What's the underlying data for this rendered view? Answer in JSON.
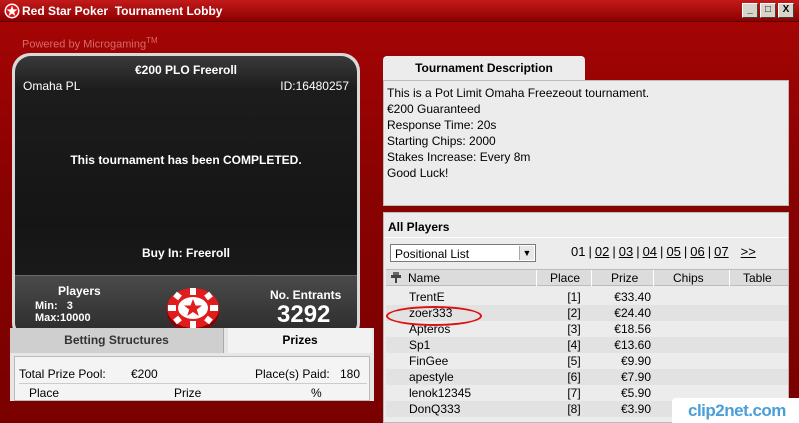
{
  "window": {
    "title": "Red Star Poker  Tournament Lobby",
    "minimize_label": "_",
    "restore_label": "□",
    "close_label": "X"
  },
  "header": {
    "powered_by": "Powered by Microgaming",
    "tm": "TM"
  },
  "tournament": {
    "name": "€200 PLO Freeroll",
    "game": "Omaha PL",
    "id": "ID:16480257",
    "status": "This tournament has been COMPLETED.",
    "buy_in": "Buy In: Freeroll",
    "players_label": "Players",
    "min": "Min:   3",
    "max": "Max:10000",
    "entrants_label": "No. Entrants",
    "entrants": "3292"
  },
  "left_tabs": {
    "betting": "Betting Structures",
    "prizes": "Prizes"
  },
  "prizes": {
    "total_label": "Total Prize Pool:",
    "total_value": "€200",
    "paid_label": "Place(s) Paid:",
    "paid_value": "180",
    "col_place": "Place",
    "col_prize": "Prize",
    "col_pct": "%"
  },
  "description": {
    "tab": "Tournament Description",
    "lines": [
      "This is a Pot Limit Omaha Freezeout tournament.",
      "€200 Guaranteed",
      "Response Time: 20s",
      "Starting Chips: 2000",
      "Stakes Increase: Every 8m",
      "Good Luck!"
    ]
  },
  "players": {
    "title": "All Players",
    "view": "Positional List",
    "pages": [
      "01",
      "02",
      "03",
      "04",
      "05",
      "06",
      "07"
    ],
    "next": ">>",
    "columns": {
      "name": "Name",
      "place": "Place",
      "prize": "Prize",
      "chips": "Chips",
      "table": "Table"
    },
    "rows": [
      {
        "name": "TrentE",
        "place": "[1]",
        "prize": "€33.40"
      },
      {
        "name": "zoer333",
        "place": "[2]",
        "prize": "€24.40"
      },
      {
        "name": "Apteros",
        "place": "[3]",
        "prize": "€18.56"
      },
      {
        "name": "Sp1",
        "place": "[4]",
        "prize": "€13.60"
      },
      {
        "name": "FinGee",
        "place": "[5]",
        "prize": "€9.90"
      },
      {
        "name": "apestyle",
        "place": "[6]",
        "prize": "€7.90"
      },
      {
        "name": "lenok12345",
        "place": "[7]",
        "prize": "€5.90"
      },
      {
        "name": "DonQ333",
        "place": "[8]",
        "prize": "€3.90"
      }
    ]
  },
  "watermark": "clip2net.com",
  "colors": {
    "brand_red": "#a40404",
    "highlight_circle": "#dd1111"
  }
}
